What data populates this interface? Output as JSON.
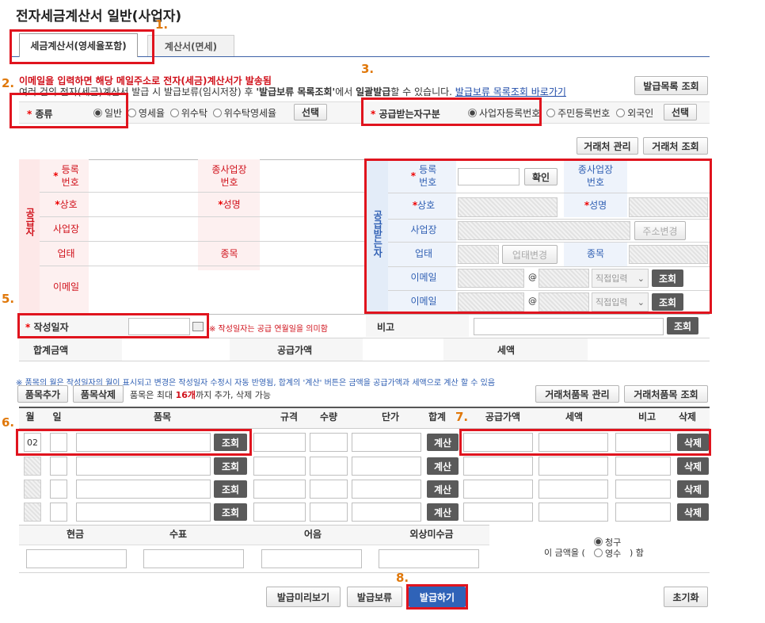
{
  "page": {
    "title": "전자세금계산서 일반(사업자)"
  },
  "tabs": [
    {
      "label": "세금계산서(영세율포함)"
    },
    {
      "label": "계산서(면세)"
    }
  ],
  "notice": {
    "line1": "이메일을 입력하면 해당 메일주소로 전자(세금)계산서가 발송됨",
    "line2_a": "여러 건의 전자(세금)계산서 발급 시 발급보류(임시저장) 후 ",
    "line2_b": "'발급보류 목록조회'",
    "line2_c": "에서 ",
    "line2_d": "일괄발급",
    "line2_e": "할 수 있습니다. ",
    "link": "발급보류 목록조회 바로가기",
    "list_button": "발급목록 조회"
  },
  "kind": {
    "label": "종류",
    "options": [
      "일반",
      "영세율",
      "위수탁",
      "위수탁영세율"
    ],
    "selected": "일반",
    "select_button": "선택"
  },
  "receiver_type": {
    "label": "공급받는자구분",
    "options": [
      "사업자등록번호",
      "주민등록번호",
      "외국인"
    ],
    "selected": "사업자등록번호",
    "select_button": "선택"
  },
  "partner": {
    "manage": "거래처 관리",
    "search": "거래처 조회"
  },
  "supplier": {
    "side": "공급자",
    "reg_no": "등록\n번호",
    "sub_no": "종사업장\n번호",
    "company": "상호",
    "name": "성명",
    "address": "사업장",
    "biz_type": "업태",
    "item": "종목",
    "email": "이메일"
  },
  "receiver": {
    "side": "공급받는자",
    "reg_no": "등록\n번호",
    "confirm": "확인",
    "sub_no": "종사업장\n번호",
    "company": "상호",
    "name": "성명",
    "address": "사업장",
    "address_change": "주소변경",
    "biz_type": "업태",
    "biz_change": "업태변경",
    "item": "종목",
    "email1": "이메일",
    "email2": "이메일",
    "at": "@",
    "direct": "직접입력",
    "search": "조회"
  },
  "date": {
    "label": "작성일자",
    "note": "※ 작성일자는 공급 연월일을 의미함",
    "remark": "비고",
    "search": "조회"
  },
  "totals": {
    "total": "합계금액",
    "supply": "공급가액",
    "tax": "세액"
  },
  "items": {
    "note": "※ 품목의 월은 작성일자의 월이 표시되고 변경은 작성일자 수정시 자동 반영됨, 합계의 '계산' 버튼은 금액을 공급가액과 세액으로 계산 할 수 있음",
    "add": "품목추가",
    "delete": "품목삭제",
    "limit_a": "품목은 최대 ",
    "limit_b": "16개",
    "limit_c": "까지 추가, 삭제 가능",
    "manage": "거래처품목 관리",
    "search": "거래처품목 조회",
    "headers": {
      "month": "월",
      "day": "일",
      "item": "품목",
      "spec": "규격",
      "qty": "수량",
      "price": "단가",
      "sum": "합계",
      "supply": "공급가액",
      "tax": "세액",
      "remark": "비고",
      "delete": "삭제"
    },
    "month_value": "02",
    "row_search": "조회",
    "calc": "계산",
    "row_delete": "삭제"
  },
  "payment": {
    "cash": "현금",
    "check": "수표",
    "bill": "어음",
    "credit": "외상미수금",
    "prefix": "이 금액을 (",
    "opt1": "청구",
    "opt2": "영수",
    "suffix": ") 함"
  },
  "actions": {
    "preview": "발급미리보기",
    "hold": "발급보류",
    "issue": "발급하기",
    "reset": "초기화"
  },
  "markers": {
    "m1": "1.",
    "m2": "2.",
    "m3": "3.",
    "m5": "5.",
    "m6": "6.",
    "m7": "7.",
    "m8": "8."
  },
  "colors": {
    "accent_red": "#e0141e",
    "supplier_bg": "#fde8e8",
    "receiver_bg": "#e3ecf8",
    "issue_btn": "#2f63b8",
    "marker": "#e0780a"
  }
}
